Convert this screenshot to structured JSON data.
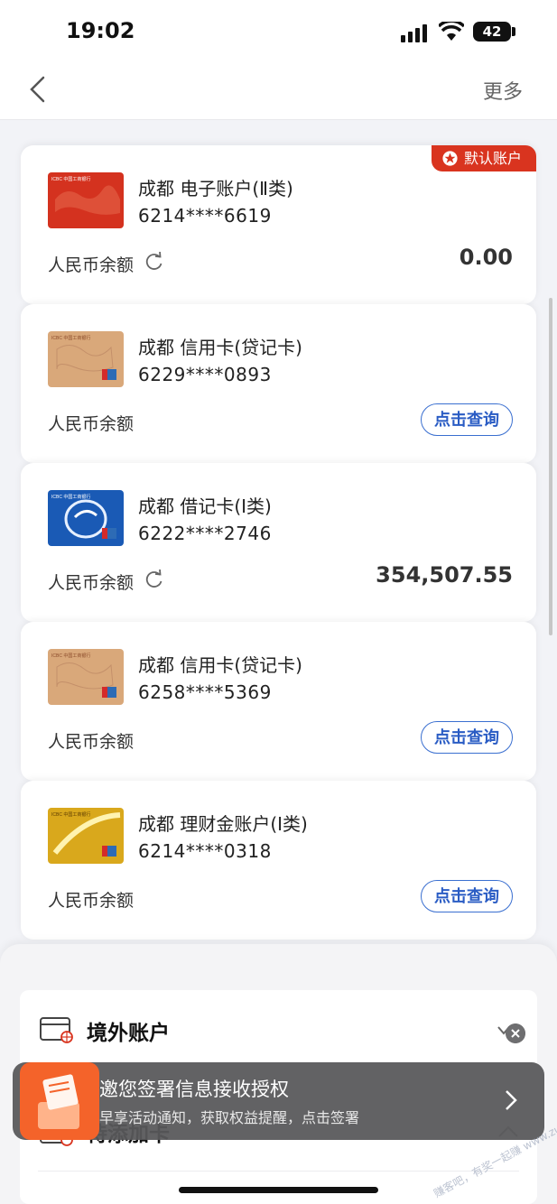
{
  "status_bar": {
    "time": "19:02",
    "battery": "42"
  },
  "nav": {
    "more_label": "更多"
  },
  "accounts": [
    {
      "name": "成都 电子账户(Ⅱ类)",
      "number": "6214****6619",
      "balance_label": "人民币余额",
      "balance": "0.00",
      "badge": "默认账户",
      "card_style": "red-world-map"
    },
    {
      "name": "成都 信用卡(贷记卡)",
      "number": "6229****0893",
      "balance_label": "人民币余额",
      "action_label": "点击查询",
      "card_style": "tan-map"
    },
    {
      "name": "成都 借记卡(Ⅰ类)",
      "number": "6222****2746",
      "balance_label": "人民币余额",
      "balance": "354,507.55",
      "card_style": "blue-e"
    },
    {
      "name": "成都 信用卡(贷记卡)",
      "number": "6258****5369",
      "balance_label": "人民币余额",
      "action_label": "点击查询",
      "card_style": "tan-map"
    },
    {
      "name": "成都 理财金账户(Ⅰ类)",
      "number": "6214****0318",
      "balance_label": "人民币余额",
      "action_label": "点击查询",
      "card_style": "gold-swoosh"
    }
  ],
  "bottom_sheet": {
    "overseas_title": "境外账户",
    "pending_title": "待添加卡"
  },
  "toast": {
    "title": "邀您签署信息接收授权",
    "subtitle": "早享活动通知，获取权益提醒，点击签署"
  },
  "watermark": "赚客吧，有奖一起赚 www.zuanke8.com",
  "colors": {
    "accent_blue": "#2a5cc4",
    "badge_red": "#d9341f",
    "icbc_red": "#c8102e"
  },
  "icons": [
    "back-arrow-icon",
    "refresh-icon",
    "star-icon",
    "card-globe-icon",
    "chevron-down-icon",
    "chevron-up-icon",
    "chevron-right-icon",
    "close-icon"
  ]
}
